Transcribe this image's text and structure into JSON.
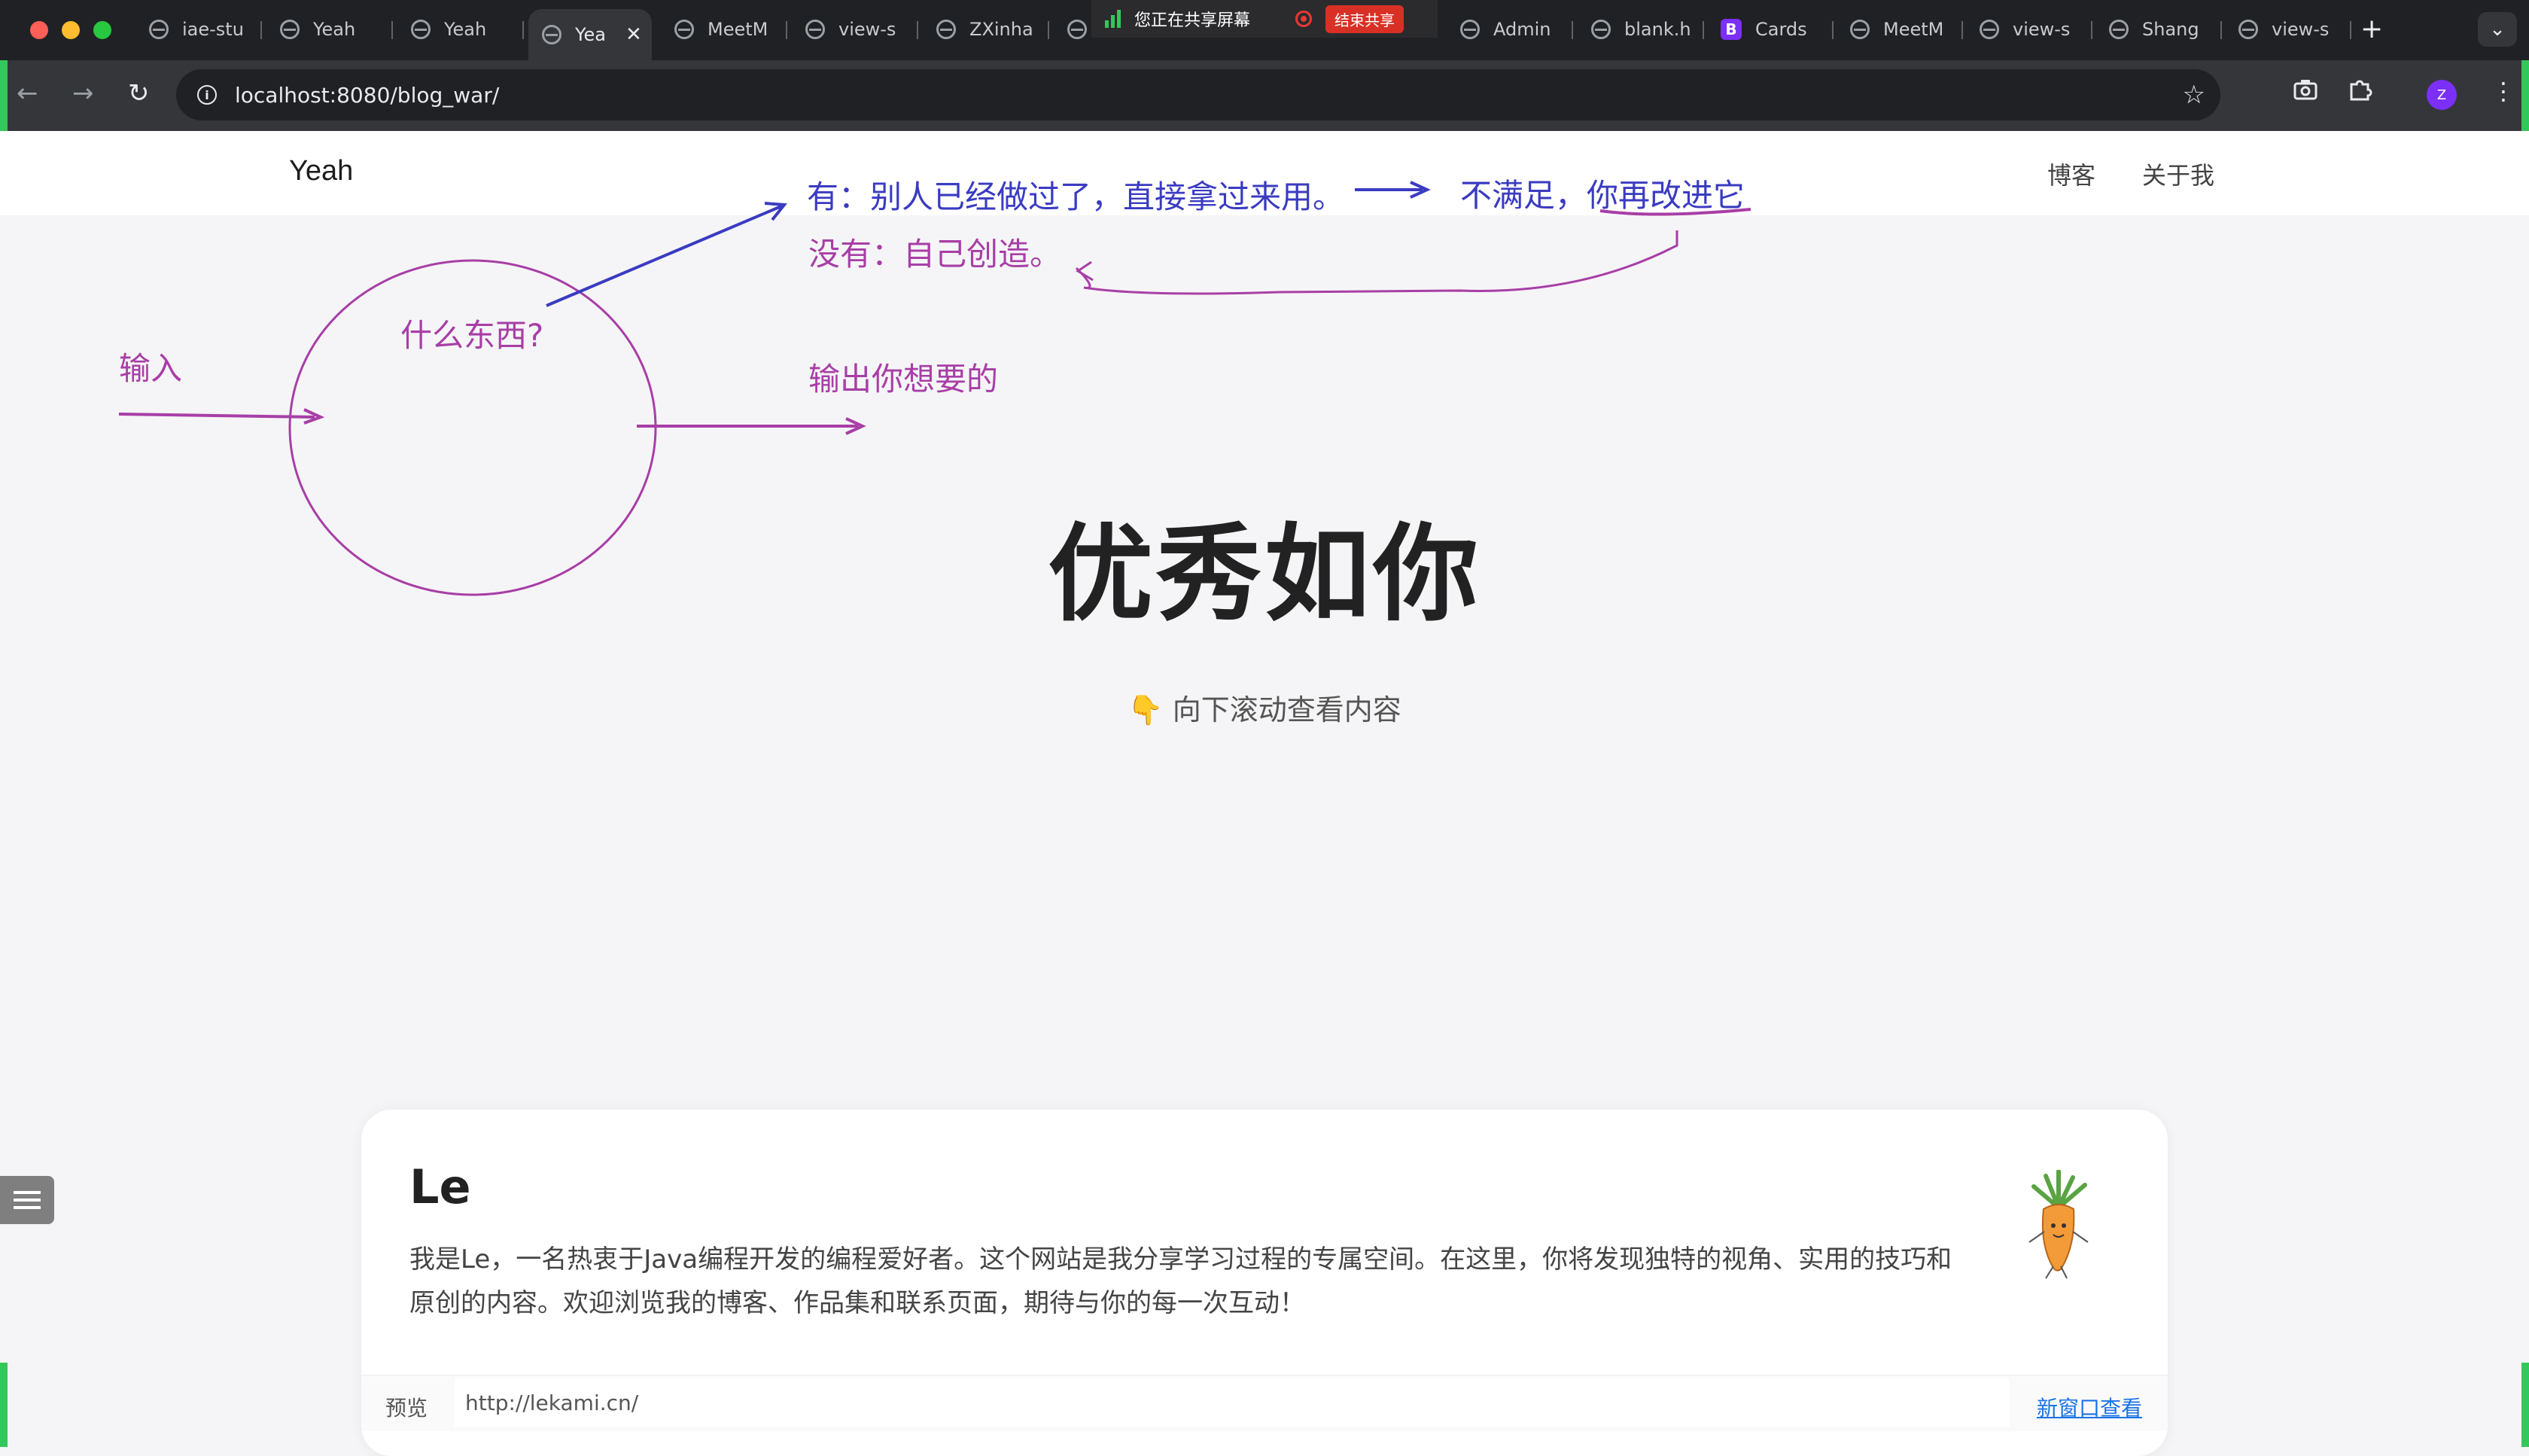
{
  "browser": {
    "tabs": [
      {
        "title": "iae-stu",
        "icon": "globe-icon"
      },
      {
        "title": "Yeah",
        "icon": "globe-icon"
      },
      {
        "title": "Yeah",
        "icon": "globe-icon"
      },
      {
        "title": "Yea",
        "icon": "globe-icon",
        "active": true
      },
      {
        "title": "MeetM",
        "icon": "globe-icon"
      },
      {
        "title": "view-s",
        "icon": "globe-icon"
      },
      {
        "title": "ZXinha",
        "icon": "globe-icon"
      },
      {
        "title": "Admin",
        "icon": "globe-icon"
      },
      {
        "title": "blank.h",
        "icon": "globe-icon"
      },
      {
        "title": "Cards",
        "icon": "bootstrap-icon"
      },
      {
        "title": "MeetM",
        "icon": "globe-icon"
      },
      {
        "title": "view-s",
        "icon": "globe-icon"
      },
      {
        "title": "Shang",
        "icon": "globe-icon"
      },
      {
        "title": "view-s",
        "icon": "globe-icon"
      }
    ],
    "share_status": "您正在共享屏幕",
    "share_stop": "结束共享",
    "url": "localhost:8080/blog_war/",
    "profile_initial": "Z",
    "accent_green": "#34c759"
  },
  "site": {
    "brand": "Yeah",
    "nav": [
      "博客",
      "关于我"
    ],
    "hero_title": "优秀如你",
    "scroll_hint": "向下滚动查看内容",
    "scroll_hint_icon": "👇"
  },
  "annotations": {
    "input": "输入",
    "what": "什么东西?",
    "output": "输出你想要的",
    "has": "有：别人已经做过了，直接拿过来用。",
    "not_satisfied": "不满足，你再改进它",
    "none": "没有：自己创造。",
    "colors": {
      "purple": "#a83ea6",
      "blue": "#3a3bc2"
    }
  },
  "card": {
    "name": "Le",
    "description": "我是Le，一名热衷于Java编程开发的编程爱好者。这个网站是我分享学习过程的专属空间。在这里，你将发现独特的视角、实用的技巧和原创的内容。欢迎浏览我的博客、作品集和联系页面，期待与你的每一次互动！",
    "preview_label": "预览",
    "preview_url": "http://lekami.cn/",
    "open_new_window": "新窗口查看",
    "avatar_icon": "carrot-icon"
  }
}
